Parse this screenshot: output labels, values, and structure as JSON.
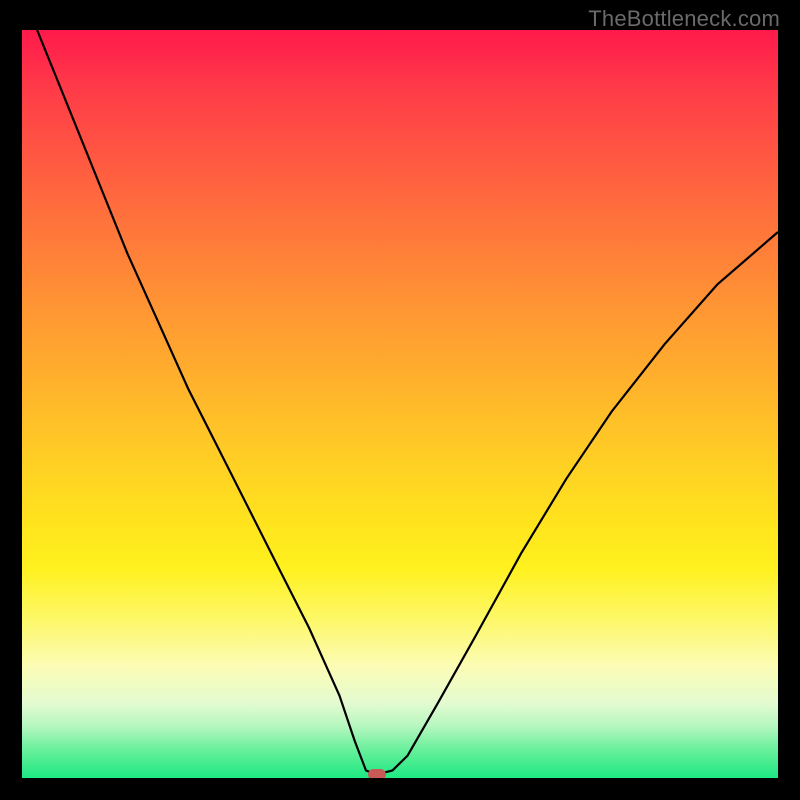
{
  "watermark": "TheBottleneck.com",
  "chart_data": {
    "type": "line",
    "title": "",
    "xlabel": "",
    "ylabel": "",
    "xlim": [
      0,
      100
    ],
    "ylim": [
      0,
      100
    ],
    "grid": false,
    "series": [
      {
        "name": "bottleneck-curve",
        "x": [
          2,
          6,
          10,
          14,
          18,
          22,
          26,
          30,
          34,
          38,
          42,
          44,
          45.5,
          47,
          49,
          51,
          55,
          60,
          66,
          72,
          78,
          85,
          92,
          100
        ],
        "values": [
          100,
          90,
          80,
          70,
          61,
          52,
          44,
          36,
          28,
          20,
          11,
          5,
          1,
          0.5,
          1,
          3,
          10,
          19,
          30,
          40,
          49,
          58,
          66,
          73
        ]
      }
    ],
    "marker": {
      "x": 47,
      "y": 0.5,
      "color": "#c55a57"
    },
    "background_gradient": {
      "stops": [
        {
          "pos": 0.0,
          "color": "#ff1a4b"
        },
        {
          "pos": 0.28,
          "color": "#ff7a3a"
        },
        {
          "pos": 0.58,
          "color": "#ffd024"
        },
        {
          "pos": 0.85,
          "color": "#fcfcb5"
        },
        {
          "pos": 1.0,
          "color": "#1de982"
        }
      ]
    }
  }
}
